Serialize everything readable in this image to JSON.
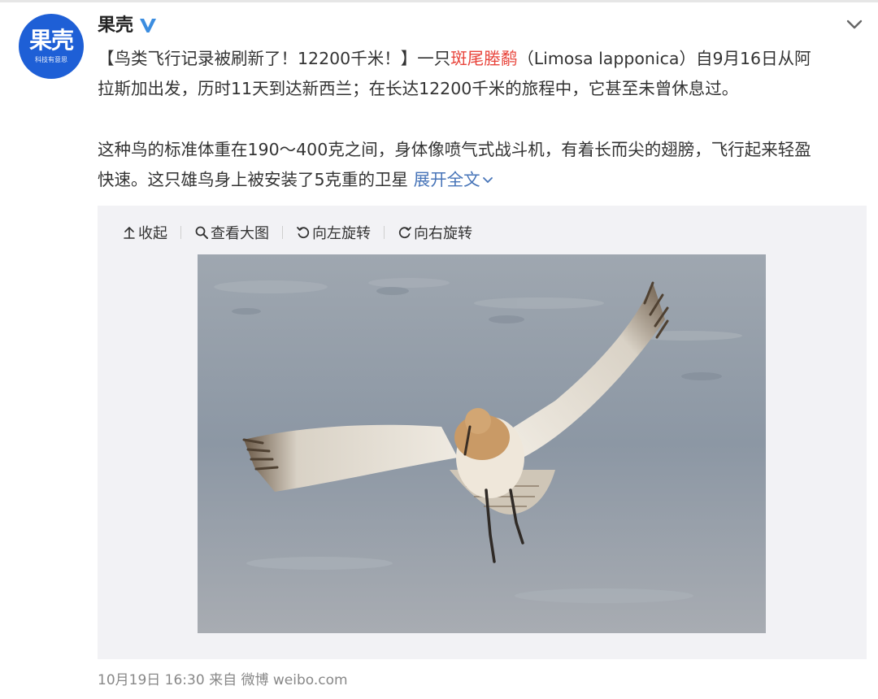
{
  "account": {
    "name": "果壳",
    "avatar_text": "果壳",
    "avatar_subtext": "科技有意思",
    "verified_icon": "verified-v-icon"
  },
  "post": {
    "p1_a": "【鸟类飞行记录被刷新了！12200千米！】一只",
    "p1_hl": "斑尾塍鹬",
    "p1_b": "（Limosa lapponica）自9月16日从阿",
    "p1_c": "拉斯加出发，历时11天到达新西兰；在长达12200千米的旅程中，它甚至未曾休息过。",
    "p2_a": "这种鸟的标准体重在190～400克之间，身体像喷气式战斗机，有着长而尖的翅膀，飞行起来轻盈",
    "p2_b": "快速。这只雄鸟身上被安装了5克重的卫星",
    "expand_label": "展开全文"
  },
  "toolbar": {
    "collapse_label": "收起",
    "view_large_label": "查看大图",
    "rotate_left_label": "向左旋转",
    "rotate_right_label": "向右旋转"
  },
  "footer": {
    "time": "10月19日 16:30",
    "source": "来自 微博 weibo.com"
  },
  "colors": {
    "brand_blue": "#1e5fd6",
    "highlight_red": "#e8453c",
    "link_blue": "#4774b8",
    "verified_blue": "#3b8de0"
  }
}
